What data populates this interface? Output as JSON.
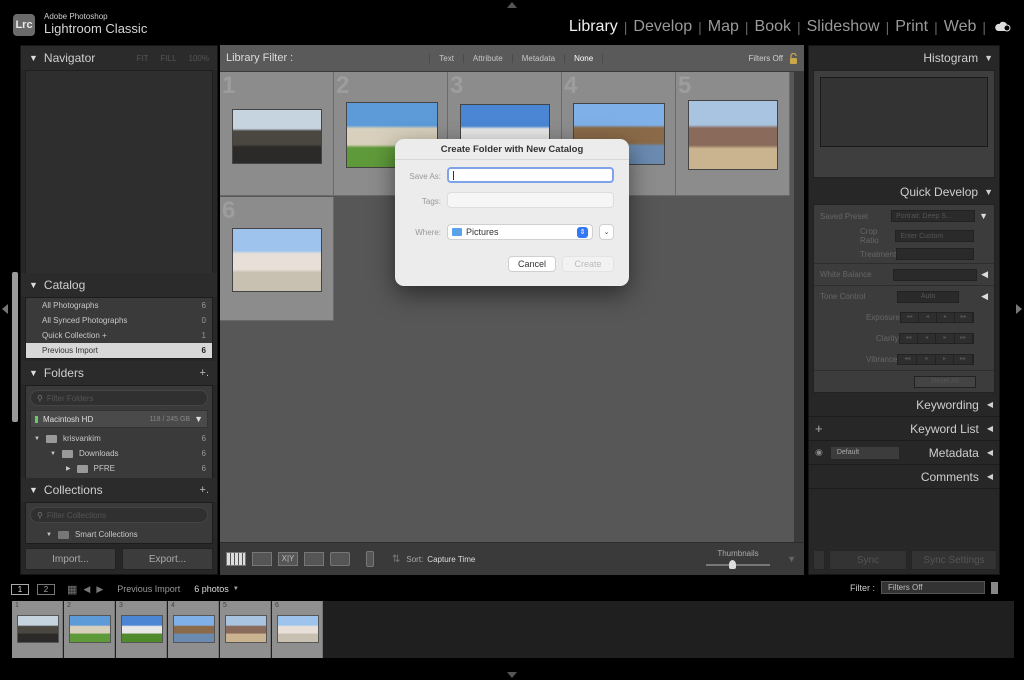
{
  "app": {
    "logo_text": "Lrc",
    "brand_line1": "Adobe Photoshop",
    "brand_line2": "Lightroom Classic"
  },
  "modules": [
    {
      "label": "Library",
      "active": true
    },
    {
      "label": "Develop",
      "active": false
    },
    {
      "label": "Map",
      "active": false
    },
    {
      "label": "Book",
      "active": false
    },
    {
      "label": "Slideshow",
      "active": false
    },
    {
      "label": "Print",
      "active": false
    },
    {
      "label": "Web",
      "active": false
    }
  ],
  "left_panel": {
    "navigator": {
      "title": "Navigator",
      "zoom_options": [
        "FIT",
        "FILL",
        "100%"
      ]
    },
    "catalog": {
      "title": "Catalog",
      "items": [
        {
          "label": "All Photographs",
          "count": "6",
          "selected": false
        },
        {
          "label": "All Synced Photographs",
          "count": "0",
          "selected": false
        },
        {
          "label": "Quick Collection +",
          "count": "1",
          "selected": false
        },
        {
          "label": "Previous Import",
          "count": "6",
          "selected": true
        }
      ]
    },
    "folders": {
      "title": "Folders",
      "add": "+.",
      "search_placeholder": "Filter Folders",
      "drive": {
        "name": "Macintosh HD",
        "capacity": "118 / 245 GB"
      },
      "tree": [
        {
          "label": "krisvankim",
          "count": "6"
        },
        {
          "label": "Downloads",
          "count": "6"
        },
        {
          "label": "PFRE",
          "count": "6"
        }
      ]
    },
    "collections": {
      "title": "Collections",
      "add": "+.",
      "search_placeholder": "Filter Collections",
      "items": [
        {
          "label": "Smart Collections"
        }
      ]
    },
    "import_label": "Import...",
    "export_label": "Export..."
  },
  "filter_bar": {
    "title": "Library Filter :",
    "tabs": [
      {
        "label": "Text",
        "active": false
      },
      {
        "label": "Attribute",
        "active": false
      },
      {
        "label": "Metadata",
        "active": false
      },
      {
        "label": "None",
        "active": true
      }
    ],
    "preset": "Filters Off"
  },
  "grid": {
    "photos": [
      {
        "index": "1",
        "colors": [
          "#c6d4e0",
          "#4a4640",
          "#2b2a29"
        ]
      },
      {
        "index": "2",
        "colors": [
          "#5c9ad8",
          "#d8d0bc",
          "#5f9a3a"
        ]
      },
      {
        "index": "3",
        "colors": [
          "#4a86d4",
          "#e8e8e8",
          "#4f8a2d"
        ]
      },
      {
        "index": "4",
        "colors": [
          "#7fb0e8",
          "#8a6a48",
          "#6a8ab0"
        ]
      },
      {
        "index": "5",
        "colors": [
          "#a8c4e0",
          "#8a6a5a",
          "#c9b48f"
        ]
      },
      {
        "index": "6",
        "colors": [
          "#9ec4ee",
          "#e8e0d8",
          "#c8c0b0"
        ]
      }
    ]
  },
  "toolbar": {
    "sort_label": "Sort:",
    "sort_value": "Capture Time",
    "thumbnails_label": "Thumbnails",
    "thumbnail_size": 0.4
  },
  "right_panel": {
    "histogram": {
      "title": "Histogram"
    },
    "quick_develop": {
      "title": "Quick Develop",
      "saved_preset_label": "Saved Preset",
      "saved_preset_value": "Portrait: Deep S...",
      "crop_ratio_label": "Crop Ratio",
      "crop_ratio_value": "Enter Custom",
      "treatment_label": "Treatment",
      "white_balance_label": "White Balance",
      "tone_control_label": "Tone Control",
      "auto_label": "Auto",
      "adjustments": [
        "Exposure",
        "Clarity",
        "Vibrance"
      ],
      "step_labels": [
        "◂◂",
        "◂",
        "▸",
        "▸▸"
      ],
      "reset_label": "Reset All"
    },
    "keywording": "Keywording",
    "keyword_list": "Keyword List",
    "metadata": "Metadata",
    "metadata_preset": "Default",
    "comments": "Comments",
    "sync_label": "Sync",
    "sync_settings_label": "Sync Settings"
  },
  "filmstrip": {
    "screen1": "1",
    "screen2": "2",
    "source": "Previous Import",
    "count": "6 photos",
    "filter_label": "Filter :",
    "filter_value": "Filters Off"
  },
  "dialog": {
    "title": "Create Folder with New Catalog",
    "save_as_label": "Save As:",
    "save_as_value": "",
    "tags_label": "Tags:",
    "tags_value": "",
    "where_label": "Where:",
    "where_value": "Pictures",
    "cancel_label": "Cancel",
    "create_label": "Create"
  }
}
